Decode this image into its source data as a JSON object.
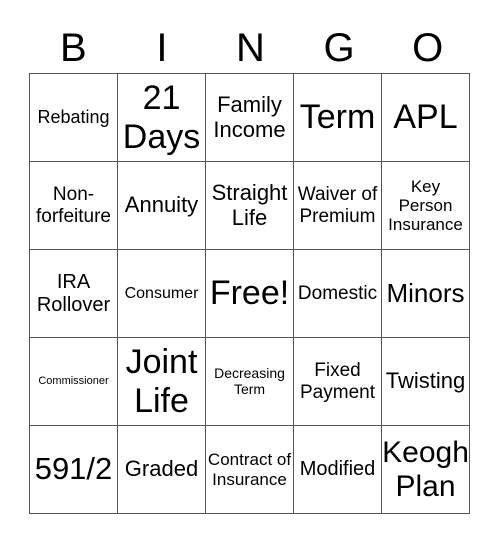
{
  "header": [
    "B",
    "I",
    "N",
    "G",
    "O"
  ],
  "cells": [
    [
      {
        "text": "Rebating",
        "size": 18
      },
      {
        "text": "21 Days",
        "size": 34
      },
      {
        "text": "Family Income",
        "size": 22
      },
      {
        "text": "Term",
        "size": 34
      },
      {
        "text": "APL",
        "size": 34
      }
    ],
    [
      {
        "text": "Non-forfeiture",
        "size": 19
      },
      {
        "text": "Annuity",
        "size": 22
      },
      {
        "text": "Straight Life",
        "size": 22
      },
      {
        "text": "Waiver of Premium",
        "size": 19
      },
      {
        "text": "Key Person Insurance",
        "size": 17
      }
    ],
    [
      {
        "text": "IRA Rollover",
        "size": 20
      },
      {
        "text": "Consumer",
        "size": 16
      },
      {
        "text": "Free!",
        "size": 34
      },
      {
        "text": "Domestic",
        "size": 19
      },
      {
        "text": "Minors",
        "size": 26
      }
    ],
    [
      {
        "text": "Commissioner",
        "size": 11
      },
      {
        "text": "Joint Life",
        "size": 34
      },
      {
        "text": "Decreasing Term",
        "size": 14
      },
      {
        "text": "Fixed Payment",
        "size": 19
      },
      {
        "text": "Twisting",
        "size": 22
      }
    ],
    [
      {
        "text": "591/2",
        "size": 31
      },
      {
        "text": "Graded",
        "size": 22
      },
      {
        "text": "Contract of Insurance",
        "size": 17
      },
      {
        "text": "Modified",
        "size": 20
      },
      {
        "text": "Keogh Plan",
        "size": 30
      }
    ]
  ]
}
